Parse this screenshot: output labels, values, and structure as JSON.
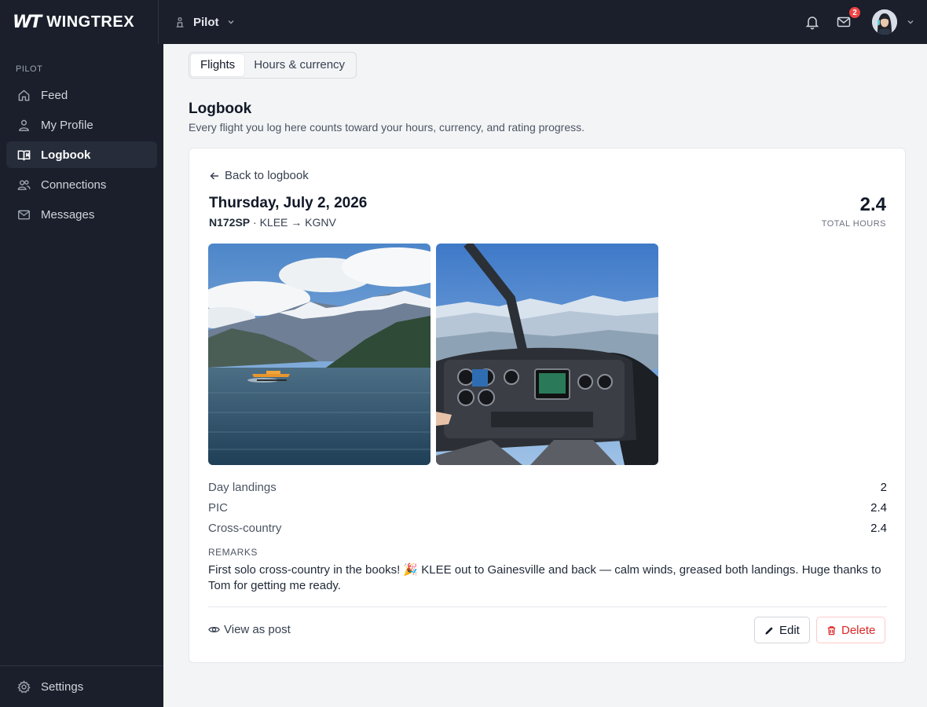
{
  "app": {
    "name": "WINGTREX",
    "logo_mark": "WT"
  },
  "header": {
    "role": "Pilot",
    "mail_badge": "2"
  },
  "sidebar": {
    "section": "PILOT",
    "items": [
      {
        "label": "Feed",
        "icon": "home-icon"
      },
      {
        "label": "My Profile",
        "icon": "user-icon"
      },
      {
        "label": "Logbook",
        "icon": "book-icon",
        "active": true
      },
      {
        "label": "Connections",
        "icon": "users-icon"
      },
      {
        "label": "Messages",
        "icon": "mail-icon"
      }
    ],
    "footer": {
      "label": "Settings",
      "icon": "gear-icon"
    }
  },
  "tabs": [
    {
      "label": "Flights",
      "active": true
    },
    {
      "label": "Hours & currency",
      "active": false
    }
  ],
  "page": {
    "title": "Logbook",
    "subtitle": "Every flight you log here counts toward your hours, currency, and rating progress."
  },
  "flight": {
    "back_label": "Back to logbook",
    "date": "Thursday, July 2, 2026",
    "tail": "N172SP",
    "route": " · KLEE → KGNV",
    "total_value": "2.4",
    "total_label": "TOTAL HOURS",
    "photos": [
      {
        "alt": "Floatplane taking off on a mountain lake"
      },
      {
        "alt": "Cockpit view over snowy mountains"
      }
    ],
    "stats": [
      {
        "label": "Day landings",
        "value": "2"
      },
      {
        "label": "PIC",
        "value": "2.4"
      },
      {
        "label": "Cross-country",
        "value": "2.4"
      }
    ],
    "remarks_label": "REMARKS",
    "remarks": "First solo cross-country in the books! 🎉 KLEE out to Gainesville and back — calm winds, greased both landings. Huge thanks to Tom for getting me ready.",
    "view_post_label": "View as post",
    "edit_label": "Edit",
    "delete_label": "Delete"
  },
  "colors": {
    "chrome": "#1a1f2b",
    "danger": "#dc2626",
    "badge": "#ef4444"
  }
}
